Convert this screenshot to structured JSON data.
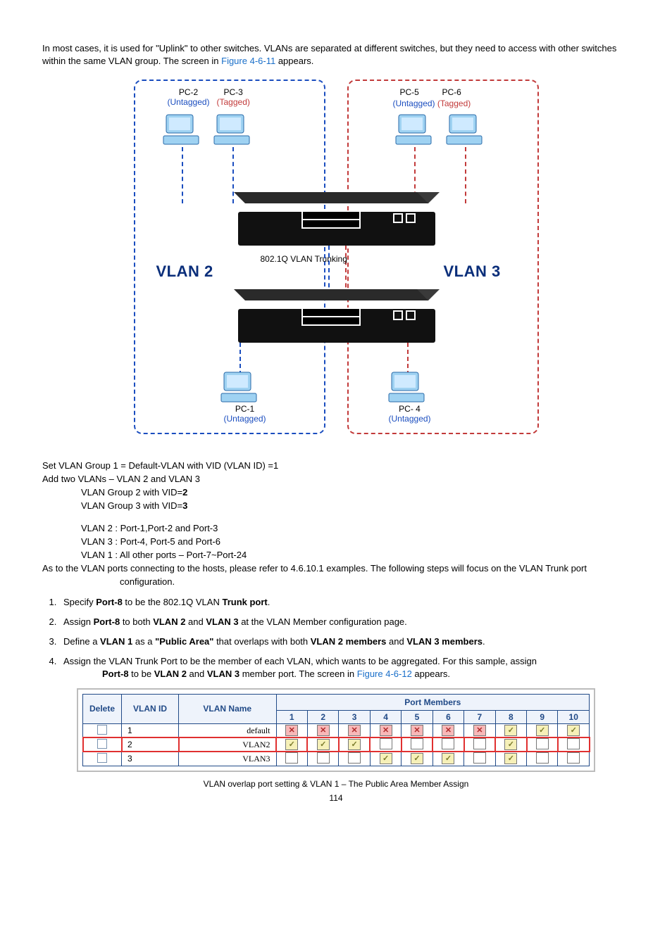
{
  "intro": {
    "t1": "In most cases, it is used for \"",
    "uplink": "Uplink",
    "t2": "\" to other switches. VLANs are separated at different switches, but they need to access with other switches within the same VLAN group. The screen in ",
    "figlink": "Figure 4-6-11",
    "t3": " appears."
  },
  "diagram": {
    "pc2": "PC-2",
    "pc3": "PC-3",
    "pc5": "PC-5",
    "pc6": "PC-6",
    "pc1": "PC-1",
    "pc4": "PC- 4",
    "untagged": "(Untagged)",
    "tagged": "(Tagged)",
    "trunk": "802.1Q VLAN Trunking",
    "vlan2": "VLAN 2",
    "vlan3": "VLAN 3"
  },
  "setup": {
    "l1": "Set VLAN Group 1 = Default-VLAN with VID (VLAN ID) =1",
    "l2": "Add two VLANs – VLAN 2 and VLAN 3",
    "l3": "VLAN Group 2 with VID=",
    "l3b": "2",
    "l4": "VLAN Group 3 with VID=",
    "l4b": "3",
    "l5": "VLAN 2 : Port-1,Port-2 and Port-3",
    "l6": "VLAN 3 : Port-4, Port-5 and Port-6",
    "l7": "VLAN 1 : All other ports – Port-7~Port-24",
    "l8a": "As to the VLAN ports connecting to the hosts, please refer to 4.6.10.1 examples. The following steps will focus on the VLAN ",
    "l8b": "Trunk port",
    "l8c": " configuration."
  },
  "steps": {
    "s1a": "Specify ",
    "s1b": "Port-8",
    "s1c": " to be the 802.1Q VLAN ",
    "s1d": "Trunk port",
    "s1e": ".",
    "s2a": "Assign ",
    "s2b": "Port-8",
    "s2c": " to both ",
    "s2d": "VLAN 2",
    "s2e": " and ",
    "s2f": "VLAN 3",
    "s2g": " at the VLAN Member configuration page.",
    "s3a": "Define a ",
    "s3b": "VLAN 1",
    "s3c": " as a ",
    "s3d": "\"Public Area\"",
    "s3e": " that overlaps with both ",
    "s3f": "VLAN 2 members",
    "s3g": " and ",
    "s3h": "VLAN 3 members",
    "s3i": ".",
    "s4a": "Assign the VLAN Trunk Port to be the member of each VLAN, which wants to be aggregated. For this sample, assign ",
    "s4b": "Port-8",
    "s4c": " to be ",
    "s4d": "VLAN 2",
    "s4e": " and ",
    "s4f": "VLAN 3",
    "s4g": " member port. The screen in ",
    "s4link": "Figure 4-6-12",
    "s4h": " appears."
  },
  "table": {
    "hdr_pm": "Port Members",
    "hdr_del": "Delete",
    "hdr_vid": "VLAN ID",
    "hdr_name": "VLAN Name",
    "ports": [
      "1",
      "2",
      "3",
      "4",
      "5",
      "6",
      "7",
      "8",
      "9",
      "10"
    ],
    "rows": [
      {
        "vid": "1",
        "name": "default",
        "pm": [
          "x",
          "x",
          "x",
          "x",
          "x",
          "x",
          "x",
          "v",
          "v",
          "v"
        ]
      },
      {
        "vid": "2",
        "name": "VLAN2",
        "pm": [
          "v",
          "v",
          "v",
          "e",
          "e",
          "e",
          "e",
          "v",
          "e",
          "e"
        ],
        "hl": true
      },
      {
        "vid": "3",
        "name": "VLAN3",
        "pm": [
          "e",
          "e",
          "e",
          "v",
          "v",
          "v",
          "e",
          "v",
          "e",
          "e"
        ]
      }
    ]
  },
  "caption": "VLAN overlap port setting & VLAN 1 – The Public Area Member Assign",
  "pagenum": "114"
}
